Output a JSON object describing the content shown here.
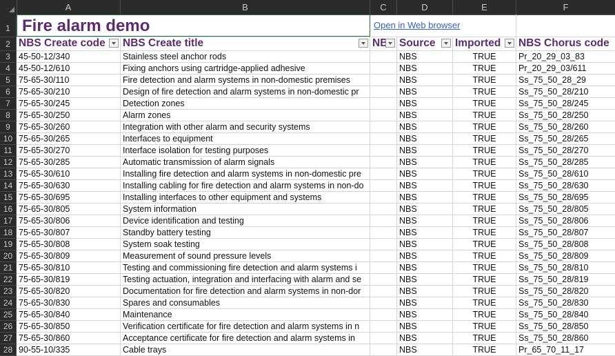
{
  "columns": [
    "A",
    "B",
    "C",
    "D",
    "E",
    "F"
  ],
  "title": "Fire alarm demo",
  "link_text": "Open in Web browser",
  "headers": {
    "a": "NBS Create code",
    "b": "NBS Create title",
    "c": "NBS",
    "d": "Source",
    "e": "Imported",
    "f": "NBS Chorus code"
  },
  "rows": [
    {
      "n": "3",
      "a": "45-50-12/340",
      "b": "Stainless steel anchor rods",
      "d": "NBS",
      "e": "TRUE",
      "f": "Pr_20_29_03_83"
    },
    {
      "n": "4",
      "a": "45-50-12/610",
      "b": "Fixing anchors using cartridge-applied adhesive",
      "d": "NBS",
      "e": "TRUE",
      "f": "Pr_20_29_03/611"
    },
    {
      "n": "5",
      "a": "75-65-30/110",
      "b": "Fire detection and alarm systems in non-domestic premises",
      "d": "NBS",
      "e": "TRUE",
      "f": "Ss_75_50_28_29"
    },
    {
      "n": "6",
      "a": "75-65-30/210",
      "b": "Design of fire detection and alarm systems in non-domestic pr",
      "d": "NBS",
      "e": "TRUE",
      "f": "Ss_75_50_28/210"
    },
    {
      "n": "7",
      "a": "75-65-30/245",
      "b": "Detection zones",
      "d": "NBS",
      "e": "TRUE",
      "f": "Ss_75_50_28/245"
    },
    {
      "n": "8",
      "a": "75-65-30/250",
      "b": "Alarm zones",
      "d": "NBS",
      "e": "TRUE",
      "f": "Ss_75_50_28/250"
    },
    {
      "n": "9",
      "a": "75-65-30/260",
      "b": "Integration with other alarm and security systems",
      "d": "NBS",
      "e": "TRUE",
      "f": "Ss_75_50_28/260"
    },
    {
      "n": "10",
      "a": "75-65-30/265",
      "b": "Interfaces to equipment",
      "d": "NBS",
      "e": "TRUE",
      "f": "Ss_75_50_28/265"
    },
    {
      "n": "11",
      "a": "75-65-30/270",
      "b": "Interface isolation for testing purposes",
      "d": "NBS",
      "e": "TRUE",
      "f": "Ss_75_50_28/270"
    },
    {
      "n": "12",
      "a": "75-65-30/285",
      "b": "Automatic transmission of alarm signals",
      "d": "NBS",
      "e": "TRUE",
      "f": "Ss_75_50_28/285"
    },
    {
      "n": "13",
      "a": "75-65-30/610",
      "b": "Installing fire detection and alarm systems in non-domestic pre",
      "d": "NBS",
      "e": "TRUE",
      "f": "Ss_75_50_28/610"
    },
    {
      "n": "14",
      "a": "75-65-30/630",
      "b": "Installing cabling for fire detection and alarm systems in non-do",
      "d": "NBS",
      "e": "TRUE",
      "f": "Ss_75_50_28/630"
    },
    {
      "n": "15",
      "a": "75-65-30/695",
      "b": "Installing interfaces to other equipment and systems",
      "d": "NBS",
      "e": "TRUE",
      "f": "Ss_75_50_28/695"
    },
    {
      "n": "16",
      "a": "75-65-30/805",
      "b": "System information",
      "d": "NBS",
      "e": "TRUE",
      "f": "Ss_75_50_28/805"
    },
    {
      "n": "17",
      "a": "75-65-30/806",
      "b": "Device identification and testing",
      "d": "NBS",
      "e": "TRUE",
      "f": "Ss_75_50_28/806"
    },
    {
      "n": "18",
      "a": "75-65-30/807",
      "b": "Standby battery testing",
      "d": "NBS",
      "e": "TRUE",
      "f": "Ss_75_50_28/807"
    },
    {
      "n": "19",
      "a": "75-65-30/808",
      "b": "System soak testing",
      "d": "NBS",
      "e": "TRUE",
      "f": "Ss_75_50_28/808"
    },
    {
      "n": "20",
      "a": "75-65-30/809",
      "b": "Measurement of sound pressure levels",
      "d": "NBS",
      "e": "TRUE",
      "f": "Ss_75_50_28/809"
    },
    {
      "n": "21",
      "a": "75-65-30/810",
      "b": "Testing and commissioning fire detection and alarm systems i",
      "d": "NBS",
      "e": "TRUE",
      "f": "Ss_75_50_28/810"
    },
    {
      "n": "22",
      "a": "75-65-30/819",
      "b": "Testing actuation, integration and interfacing with alarm and se",
      "d": "NBS",
      "e": "TRUE",
      "f": "Ss_75_50_28/819"
    },
    {
      "n": "23",
      "a": "75-65-30/820",
      "b": "Documentation for fire detection and alarm systems in non-dor",
      "d": "NBS",
      "e": "TRUE",
      "f": "Ss_75_50_28/820"
    },
    {
      "n": "24",
      "a": "75-65-30/830",
      "b": "Spares and consumables",
      "d": "NBS",
      "e": "TRUE",
      "f": "Ss_75_50_28/830"
    },
    {
      "n": "25",
      "a": "75-65-30/840",
      "b": "Maintenance",
      "d": "NBS",
      "e": "TRUE",
      "f": "Ss_75_50_28/840"
    },
    {
      "n": "26",
      "a": "75-65-30/850",
      "b": "Verification certificate for fire detection and alarm systems in n",
      "d": "NBS",
      "e": "TRUE",
      "f": "Ss_75_50_28/850"
    },
    {
      "n": "27",
      "a": "75-65-30/860",
      "b": "Acceptance certificate for fire detection and alarm systems in",
      "d": "NBS",
      "e": "TRUE",
      "f": "Ss_75_50_28/860"
    },
    {
      "n": "28",
      "a": "90-55-10/335",
      "b": "Cable trays",
      "d": "NBS",
      "e": "TRUE",
      "f": "Pr_65_70_11_17"
    }
  ]
}
